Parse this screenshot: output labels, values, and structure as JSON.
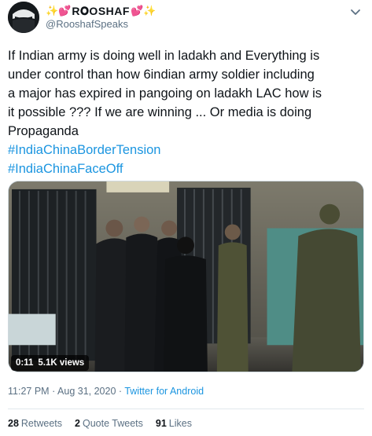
{
  "user": {
    "emoji_left": "✨💕",
    "display_name": "R𝐎OSHAF",
    "emoji_right": "💕✨",
    "handle": "@RooshafSpeaks"
  },
  "tweet": {
    "lines": [
      "If Indian army is doing well in ladakh and Everything is",
      "under control than how 6indian army soldier including",
      "a major has expired  in pangoing on ladakh LAC how is",
      "it possible ??? If we  are winning ... Or media is doing",
      "Propaganda"
    ],
    "hashtags": [
      "#IndiaChinaBorderTension",
      "#IndiaChinaFaceOff"
    ]
  },
  "video": {
    "duration": "0:11",
    "views": "5.1K views"
  },
  "meta": {
    "time": "11:27 PM",
    "separator1": "·",
    "date": "Aug 31, 2020",
    "separator2": "·",
    "app": "Twitter for Android"
  },
  "stats": [
    {
      "count": "28",
      "label": "Retweets"
    },
    {
      "count": "2",
      "label": "Quote Tweets"
    },
    {
      "count": "91",
      "label": "Likes"
    }
  ],
  "icons": {
    "avatar": "masked-face-avatar",
    "caret": "chevron-down-icon"
  },
  "colors": {
    "text": "#0f1419",
    "secondary": "#5b7083",
    "link": "#1b95e0"
  }
}
